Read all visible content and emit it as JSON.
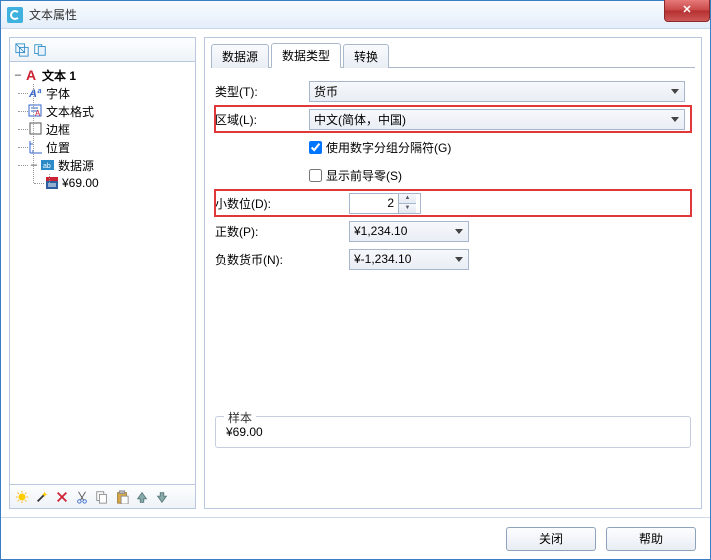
{
  "title": "文本属性",
  "close": "✕",
  "tree": {
    "root": "文本 1",
    "items": [
      "字体",
      "文本格式",
      "边框",
      "位置",
      "数据源"
    ],
    "datasource_value": "¥69.00"
  },
  "tabs": [
    "数据源",
    "数据类型",
    "转换"
  ],
  "active_tab": 1,
  "form": {
    "type_label": "类型(T):",
    "type_value": "货币",
    "region_label": "区域(L):",
    "region_value": "中文(简体，中国)",
    "use_grouping": "使用数字分组分隔符(G)",
    "use_grouping_checked": true,
    "leading_zero": "显示前导零(S)",
    "leading_zero_checked": false,
    "decimals_label": "小数位(D):",
    "decimals_value": "2",
    "positive_label": "正数(P):",
    "positive_value": "¥1,234.10",
    "negative_label": "负数货币(N):",
    "negative_value": "¥-1,234.10"
  },
  "sample": {
    "legend": "样本",
    "value": "¥69.00"
  },
  "footer": {
    "close": "关闭",
    "help": "帮助"
  }
}
